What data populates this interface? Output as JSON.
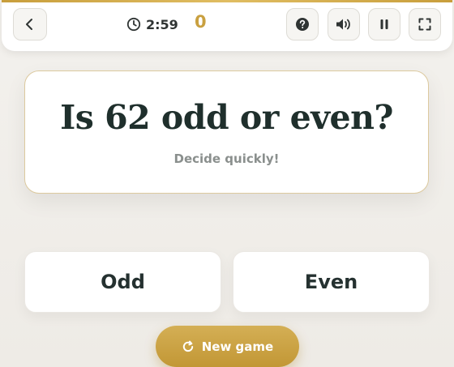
{
  "header": {
    "timer": "2:59",
    "score": "0",
    "accent_color": "#c89e3c",
    "icons": {
      "back": "chevron-left-icon",
      "timer": "clock-icon",
      "help": "question-circle-icon",
      "sound": "speaker-icon",
      "pause": "pause-icon",
      "fullscreen": "expand-icon"
    }
  },
  "question": {
    "text": "Is 62 odd or even?",
    "hint": "Decide quickly!"
  },
  "answers": {
    "odd_label": "Odd",
    "even_label": "Even"
  },
  "actions": {
    "new_game_label": "New game",
    "new_game_icon": "refresh-icon",
    "button_color": "#c9a040"
  }
}
